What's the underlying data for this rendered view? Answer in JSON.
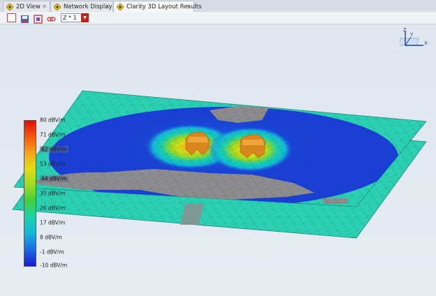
{
  "tabs": [
    {
      "label": "2D View",
      "active": false
    },
    {
      "label": "Network Display",
      "active": false
    },
    {
      "label": "Clarity 3D Layout Results",
      "active": true
    }
  ],
  "toolbar": {
    "z_select_value": "Z * 1",
    "icons": [
      "box-select-icon",
      "save-view-icon",
      "fit-view-icon",
      "link-icon"
    ]
  },
  "legend": {
    "labels": [
      "80 dBV/m",
      "71 dBV/m",
      "62 dBV/m",
      "53 dBV/m",
      "44 dBV/m",
      "35 dBV/m",
      "26 dBV/m",
      "17 dBV/m",
      "8 dBV/m",
      "-1 dBV/m",
      "-10 dBV/m"
    ],
    "colors": [
      "#e00d0d",
      "#f25a0c",
      "#f7a21b",
      "#e2de13",
      "#9edc22",
      "#44cf38",
      "#1ad3ab",
      "#12b9d9",
      "#1a6ee6",
      "#1a1ad4"
    ]
  },
  "axis": {
    "z": "Z",
    "y": "Y",
    "x": "X"
  },
  "colors": {
    "tab_active": "#f6f7f9",
    "dropdown_arrow": "#b5271d",
    "plane_cyan": "#2bd3b4",
    "field_blue": "#1a3fd6",
    "void_gray": "#8e8e8e"
  }
}
